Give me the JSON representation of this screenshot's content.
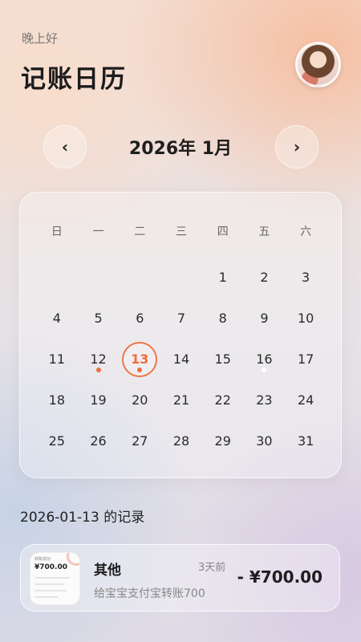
{
  "header": {
    "greeting": "晚上好",
    "title": "记账日历"
  },
  "nav": {
    "prev_icon": "‹",
    "next_icon": "›",
    "month_label": "2026年 1月"
  },
  "calendar": {
    "weekdays": [
      "日",
      "一",
      "二",
      "三",
      "四",
      "五",
      "六"
    ],
    "days": [
      "",
      "",
      "",
      "",
      "1",
      "2",
      "3",
      "4",
      "5",
      "6",
      "7",
      "8",
      "9",
      "10",
      "11",
      "12",
      "13",
      "14",
      "15",
      "16",
      "17",
      "18",
      "19",
      "20",
      "21",
      "22",
      "23",
      "24",
      "25",
      "26",
      "27",
      "28",
      "29",
      "30",
      "31"
    ],
    "selected_day": "13",
    "dots": {
      "12": "orange",
      "13": "orange",
      "16": "white"
    },
    "accent_color": "#ee6d3c"
  },
  "records": {
    "title": "2026-01-13 的记录",
    "items": [
      {
        "thumbnail": {
          "top_text": "转账成功",
          "amount": "¥700.00"
        },
        "category": "其他",
        "time_ago": "3天前",
        "description": "给宝宝支付宝转账700",
        "amount": "- ¥700.00"
      }
    ]
  }
}
